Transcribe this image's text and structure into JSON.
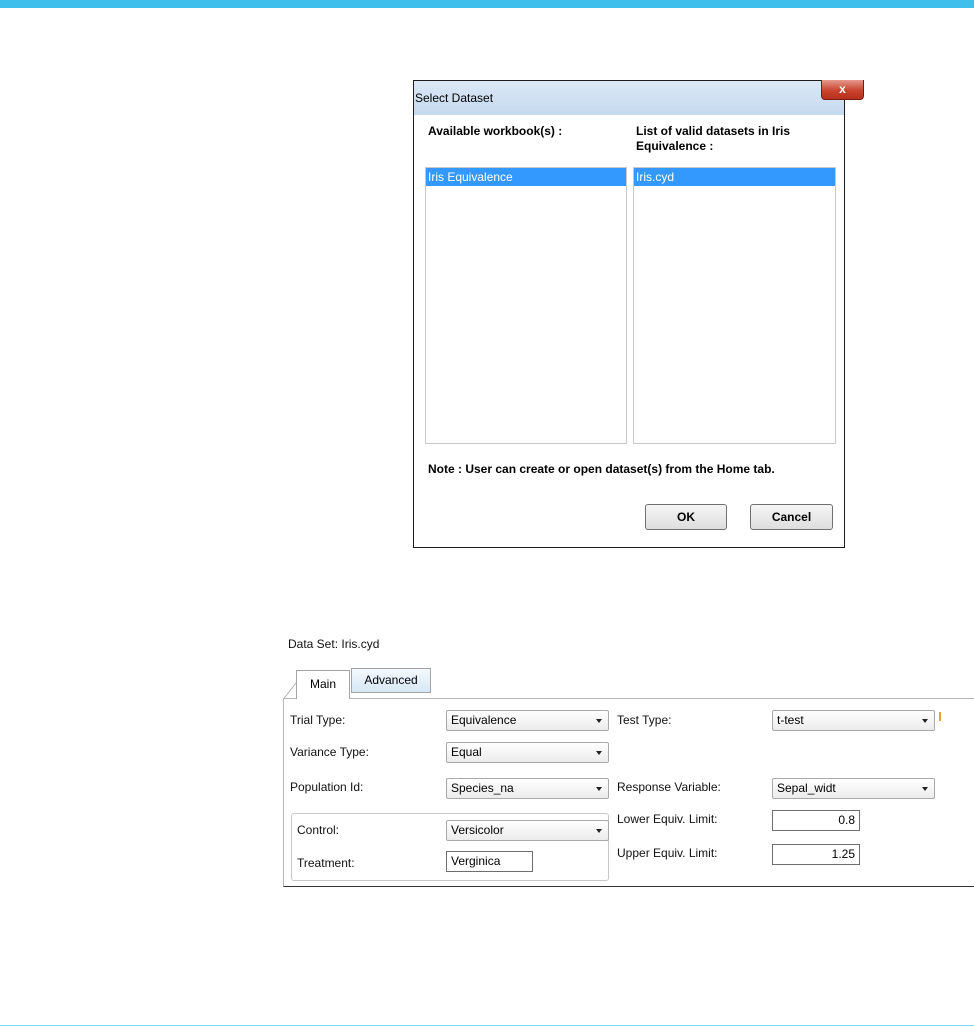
{
  "dialog": {
    "title": "Select Dataset",
    "close_glyph": "x",
    "workbooks_label": "Available workbook(s) :",
    "datasets_label_line1": "List of valid datasets in Iris",
    "datasets_label_line2": "Equivalence :",
    "workbooks": [
      "Iris Equivalence"
    ],
    "datasets": [
      "Iris.cyd"
    ],
    "note": "Note : User can create or open dataset(s) from the Home tab.",
    "ok_label": "OK",
    "cancel_label": "Cancel"
  },
  "form": {
    "dataset_label": "Data Set: Iris.cyd",
    "tabs": [
      {
        "label": "Main"
      },
      {
        "label": "Advanced"
      }
    ],
    "trial_type": {
      "label": "Trial Type:",
      "value": "Equivalence"
    },
    "variance_type": {
      "label": "Variance Type:",
      "value": "Equal"
    },
    "population_id": {
      "label": "Population Id:",
      "value": "Species_na"
    },
    "control": {
      "label": "Control:",
      "value": "Versicolor"
    },
    "treatment": {
      "label": "Treatment:",
      "value": "Verginica"
    },
    "test_type": {
      "label": "Test Type:",
      "value": "t-test"
    },
    "response_variable": {
      "label": "Response Variable:",
      "value": "Sepal_widt"
    },
    "lower_limit": {
      "label": "Lower Equiv. Limit:",
      "value": "0.8"
    },
    "upper_limit": {
      "label": "Upper Equiv. Limit:",
      "value": "1.25"
    }
  },
  "colors": {
    "top_bar": "#3fc0ec",
    "selection": "#3399ff",
    "close_button": "#c8442f"
  }
}
